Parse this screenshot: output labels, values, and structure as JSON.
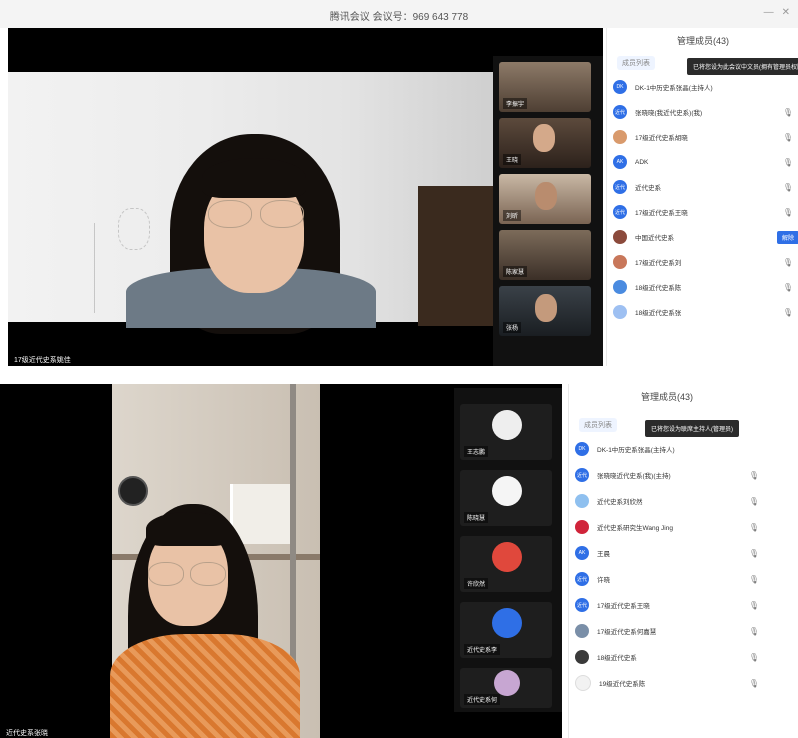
{
  "top_window": {
    "title": "腾讯会议 会议号：969 643 778",
    "window_controls": [
      "—",
      "✕"
    ],
    "main_speaker_name": "17级近代史系姚佳",
    "thumbnails": [
      {
        "name": "李振宇"
      },
      {
        "name": "王晓"
      },
      {
        "name": "刘昕"
      },
      {
        "name": "陈家慧"
      },
      {
        "name": "张杨"
      }
    ],
    "sidebar": {
      "title": "管理成员(43)",
      "tab_label": "成员列表",
      "toast": "已将您设为此会议中文员(拥有管理员权限)",
      "participants": [
        {
          "avatar": "DK",
          "name": "DK-1中历史系张晶(主持人)"
        },
        {
          "avatar": "近代",
          "name": "张晓晓(我近代史系)(我)"
        },
        {
          "avatar": "",
          "name": "17级近代史系胡晓"
        },
        {
          "avatar": "AK",
          "name": "ADK"
        },
        {
          "avatar": "近代",
          "name": "近代史系"
        },
        {
          "avatar": "近代",
          "name": "17级近代史系王晓"
        },
        {
          "avatar": "",
          "name": "中国近代史系"
        },
        {
          "avatar": "",
          "name": "17级近代史系刘"
        },
        {
          "avatar": "",
          "name": "18级近代史系陈"
        },
        {
          "avatar": "",
          "name": "18级近代史系张"
        }
      ],
      "action_button": "解除"
    }
  },
  "bottom_window": {
    "main_speaker_name": "近代史系张晓",
    "thumbnails": [
      {
        "name": "王志鹏"
      },
      {
        "name": "陈晓慧"
      },
      {
        "name": "许欣然"
      },
      {
        "name": "近代史系李"
      },
      {
        "name": "近代史系何"
      }
    ],
    "sidebar": {
      "title": "管理成员(43)",
      "tab_label": "成员列表",
      "toast": "已将您设为联席主持人(管理员)",
      "participants": [
        {
          "avatar": "DK",
          "name": "DK-1中历史系张晶(主持人)"
        },
        {
          "avatar": "近代",
          "name": "张晓晓近代史系(我)(主持)"
        },
        {
          "avatar": "",
          "name": "近代史系刘欣然"
        },
        {
          "avatar": "",
          "name": "近代史系研究生Wang Jing"
        },
        {
          "avatar": "AK",
          "name": "王晨"
        },
        {
          "avatar": "近代",
          "name": "许晓"
        },
        {
          "avatar": "近代",
          "name": "17级近代史系王晓"
        },
        {
          "avatar": "",
          "name": "17级近代史系何嘉慧"
        },
        {
          "avatar": "",
          "name": "18级近代史系"
        },
        {
          "avatar": "",
          "name": "19级近代史系陈"
        }
      ]
    }
  }
}
